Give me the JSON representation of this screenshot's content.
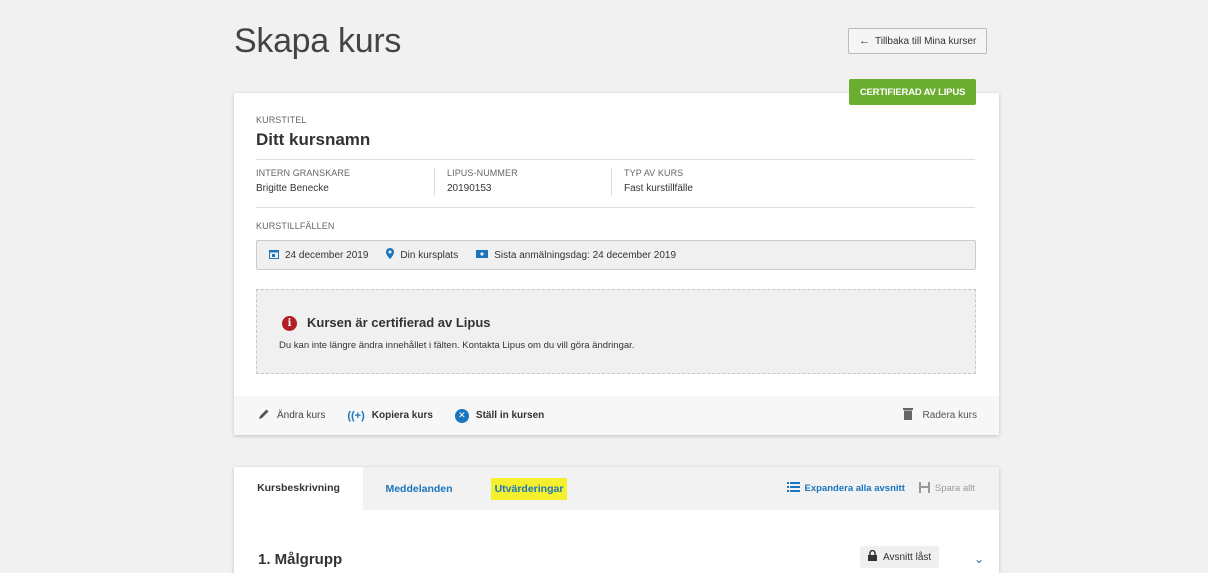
{
  "header": {
    "title": "Skapa kurs",
    "back_label": "Tillbaka till Mina kurser"
  },
  "badge": {
    "certified_label": "CERTIFIERAD AV LIPUS",
    "color": "#6aad2f"
  },
  "course": {
    "title_label": "KURSTITEL",
    "title_value": "Ditt kursnamn",
    "meta": [
      {
        "label": "INTERN GRANSKARE",
        "value": "Brigitte Benecke"
      },
      {
        "label": "LIPUS-NUMMER",
        "value": "20190153"
      },
      {
        "label": "TYP AV KURS",
        "value": "Fast kurstillfälle"
      }
    ],
    "occasions_label": "KURSTILLFÄLLEN",
    "occasion": {
      "date": "24 december 2019",
      "place": "Din kursplats",
      "deadline": "Sista anmälningsdag: 24 december 2019"
    }
  },
  "notice": {
    "icon": "info-icon",
    "title": "Kursen är certifierad av Lipus",
    "text": "Du kan inte längre ändra innehållet i fälten. Kontakta Lipus om du vill göra ändringar."
  },
  "actions": {
    "edit": "Ändra kurs",
    "copy": "Kopiera kurs",
    "cancel": "Ställ in kursen",
    "delete": "Radera kurs"
  },
  "tabs": [
    {
      "label": "Kursbeskrivning"
    },
    {
      "label": "Meddelanden"
    },
    {
      "label": "Utvärderingar"
    }
  ],
  "tab_actions": {
    "expand": "Expandera alla avsnitt",
    "save": "Spara allt"
  },
  "section": {
    "title": "1. Målgrupp",
    "locked_label": "Avsnitt låst"
  },
  "colors": {
    "accent": "#1b75bc",
    "highlight": "#f4f02e",
    "error": "#b11f24"
  }
}
